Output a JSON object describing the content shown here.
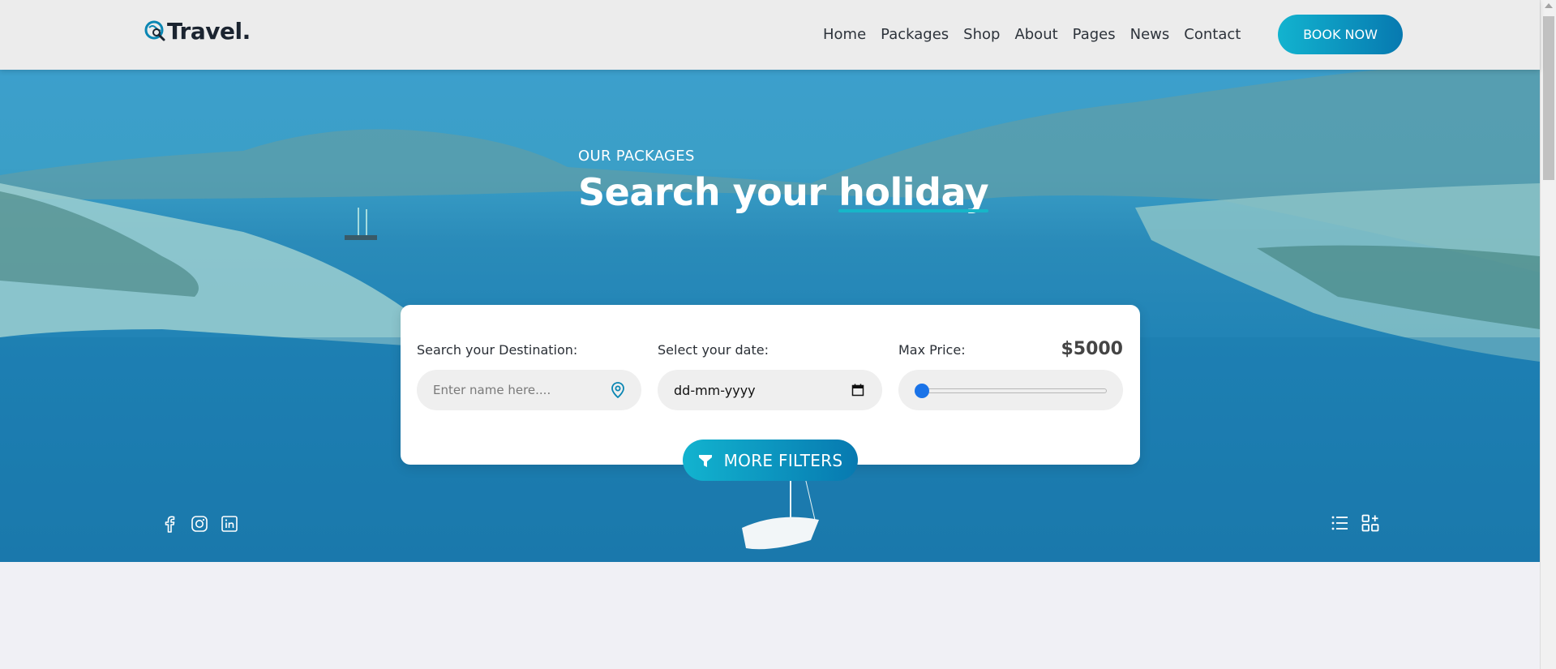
{
  "brand": {
    "name": "Travel."
  },
  "nav": {
    "items": [
      "Home",
      "Packages",
      "Shop",
      "About",
      "Pages",
      "News",
      "Contact"
    ],
    "cta": "BOOK NOW"
  },
  "hero": {
    "eyebrow": "OUR PACKAGES",
    "title_prefix": "Search your ",
    "title_highlight": "holiday"
  },
  "search": {
    "destination": {
      "label": "Search your Destination:",
      "placeholder": "Enter name here...."
    },
    "date": {
      "label": "Select your date:",
      "value": "dd-mm-yyyy"
    },
    "price": {
      "label": "Max Price:",
      "value": "$5000",
      "slider_fraction": 0
    },
    "filters_label": "MORE FILTERS"
  },
  "social": [
    "facebook-icon",
    "instagram-icon",
    "linkedin-icon"
  ],
  "view_toggles": [
    "list-view-icon",
    "grid-view-icon"
  ],
  "colors": {
    "accent_start": "#12b3cf",
    "accent_end": "#0779b0",
    "highlight": "#17b6c8",
    "slider_thumb": "#1a73e8"
  }
}
